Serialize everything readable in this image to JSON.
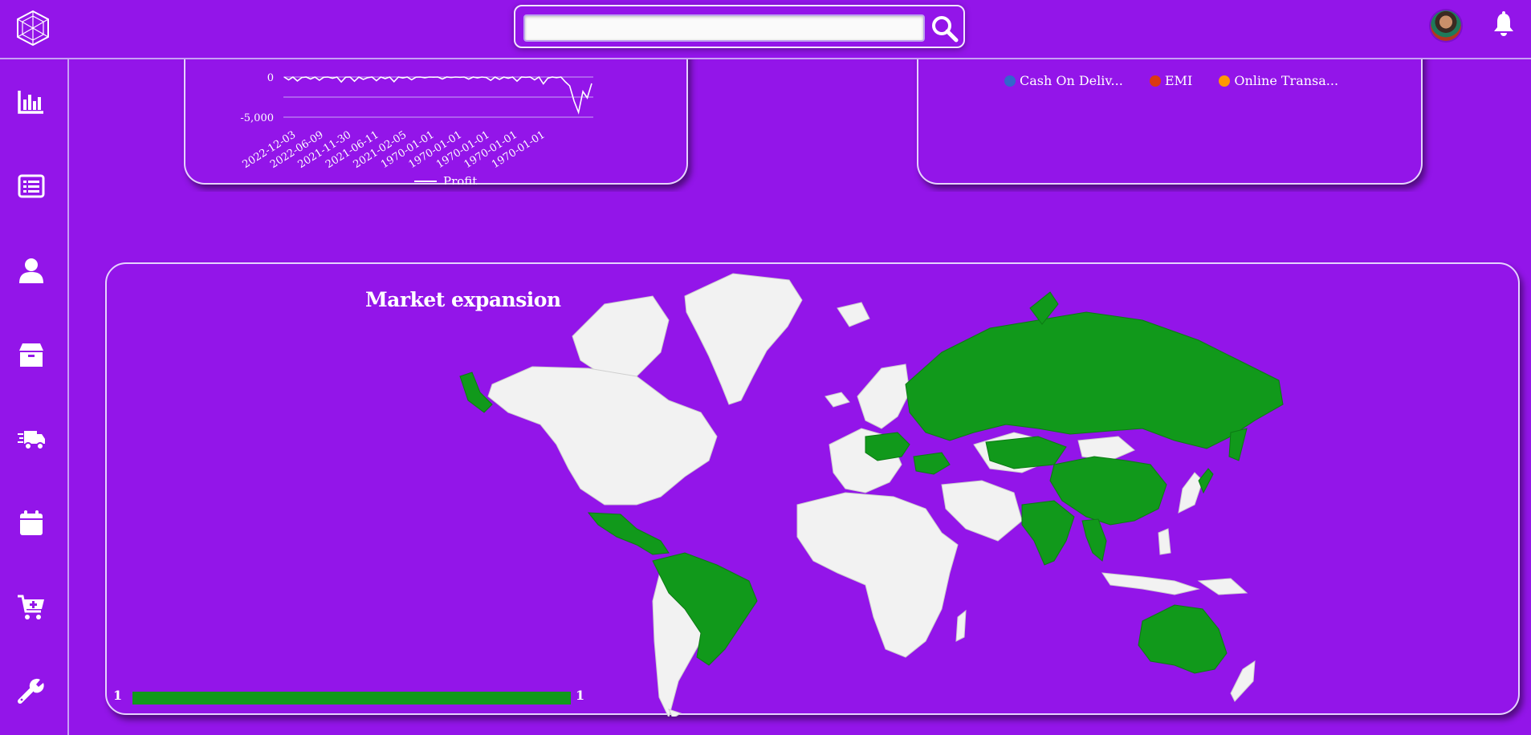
{
  "header": {
    "search": {
      "value": "",
      "placeholder": ""
    },
    "icons": {
      "logo": "hexagon-globe-logo",
      "search": "search-icon",
      "avatar": "user-avatar",
      "bell": "bell-icon"
    }
  },
  "sidebar": {
    "items": [
      {
        "icon": "bar-chart-icon"
      },
      {
        "icon": "list-icon"
      },
      {
        "icon": "user-icon"
      },
      {
        "icon": "box-icon"
      },
      {
        "icon": "delivery-truck-icon"
      },
      {
        "icon": "calendar-icon"
      },
      {
        "icon": "cart-plus-icon"
      },
      {
        "icon": "wrench-icon"
      }
    ]
  },
  "colors": {
    "background": "#9315e9",
    "land": "#f2f2f2",
    "highlight": "#11991b",
    "cod": "#3366cc",
    "emi": "#dc3912",
    "online": "#ff9900"
  },
  "profit_chart": {
    "chart_data": {
      "type": "line",
      "series": [
        {
          "name": "Profit"
        }
      ],
      "y_ticks": [
        "0",
        "-5,000"
      ],
      "x_ticks": [
        "2022-12-03",
        "2022-06-09",
        "2021-11-30",
        "2021-06-11",
        "2021-02-05",
        "1970-01-01",
        "1970-01-01",
        "1970-01-01",
        "1970-01-01",
        "1970-01-01"
      ],
      "values": [
        0,
        -350,
        0,
        -500,
        -60,
        0,
        -250,
        0,
        -400,
        -30,
        0,
        -150,
        0,
        -620,
        -20,
        0,
        -530,
        0,
        -300,
        -80,
        0,
        -460,
        0,
        -200,
        0,
        -580,
        0,
        -120,
        0,
        -340,
        -20,
        0,
        -90,
        0,
        -20,
        0,
        -250,
        0,
        -60,
        0,
        -30,
        0,
        -260,
        0,
        -100,
        0,
        -60,
        -420,
        0,
        -300,
        0,
        -150,
        0,
        -520,
        0,
        -30,
        0,
        -360,
        0,
        -850,
        -150,
        0,
        -80,
        0,
        -600,
        -1100,
        -3000,
        -4400,
        -1800,
        -2600,
        -800
      ]
    }
  },
  "payment_chart": {
    "legend": [
      {
        "label": "Cash On Deliv...",
        "color": "#3366cc"
      },
      {
        "label": "EMI",
        "color": "#dc3912"
      },
      {
        "label": "Online Transa...",
        "color": "#ff9900"
      }
    ]
  },
  "market": {
    "title": "Market expansion",
    "scale_min": "1",
    "scale_max": "1",
    "highlighted_regions": [
      "Mexico",
      "Central America",
      "Colombia",
      "Venezuela",
      "Brazil",
      "Germany",
      "Poland",
      "Ukraine",
      "Russia",
      "Kazakhstan",
      "China",
      "India",
      "Myanmar",
      "Thailand",
      "Japan",
      "Australia",
      "Alaska Peninsula"
    ]
  }
}
